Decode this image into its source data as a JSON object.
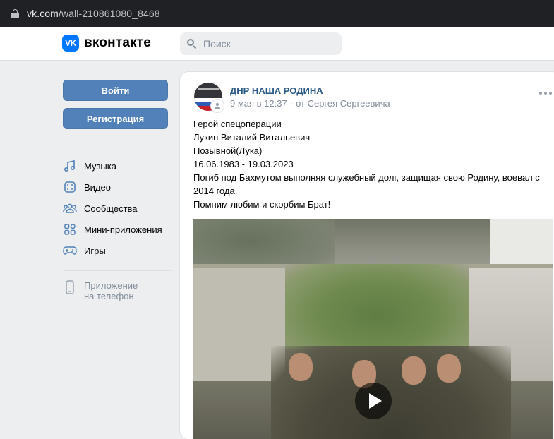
{
  "browser": {
    "url_domain": "vk.com",
    "url_path": "/wall-210861080_8468"
  },
  "header": {
    "logo_mark": "VK",
    "logo_text": "вконтакте",
    "search_placeholder": "Поиск"
  },
  "sidebar": {
    "login_label": "Войти",
    "register_label": "Регистрация",
    "items": [
      {
        "label": "Музыка",
        "icon": "music-icon"
      },
      {
        "label": "Видео",
        "icon": "video-icon"
      },
      {
        "label": "Сообщества",
        "icon": "communities-icon"
      },
      {
        "label": "Мини-приложения",
        "icon": "mini-apps-icon"
      },
      {
        "label": "Игры",
        "icon": "games-icon"
      }
    ],
    "app_line1": "Приложение",
    "app_line2": "на телефон"
  },
  "post": {
    "group_name": "ДНР НАША РОДИНА",
    "date": "9 мая в 12:37",
    "author": "от Сергея Сергеевича",
    "lines": [
      "Герой спецоперации",
      "Лукин Виталий Витальевич",
      "Позывной(Лука)",
      "16.06.1983 - 19.03.2023",
      "Погиб под Бахмутом выполняя служебный долг, защищая свою Родину, воевал с",
      "2014 года.",
      "Помним любим и скорбим Брат!"
    ]
  },
  "colors": {
    "accent": "#0077ff",
    "button": "#5181b8",
    "link": "#2a5885",
    "secondary_text": "#818c99",
    "page_bg": "#edeef0"
  }
}
